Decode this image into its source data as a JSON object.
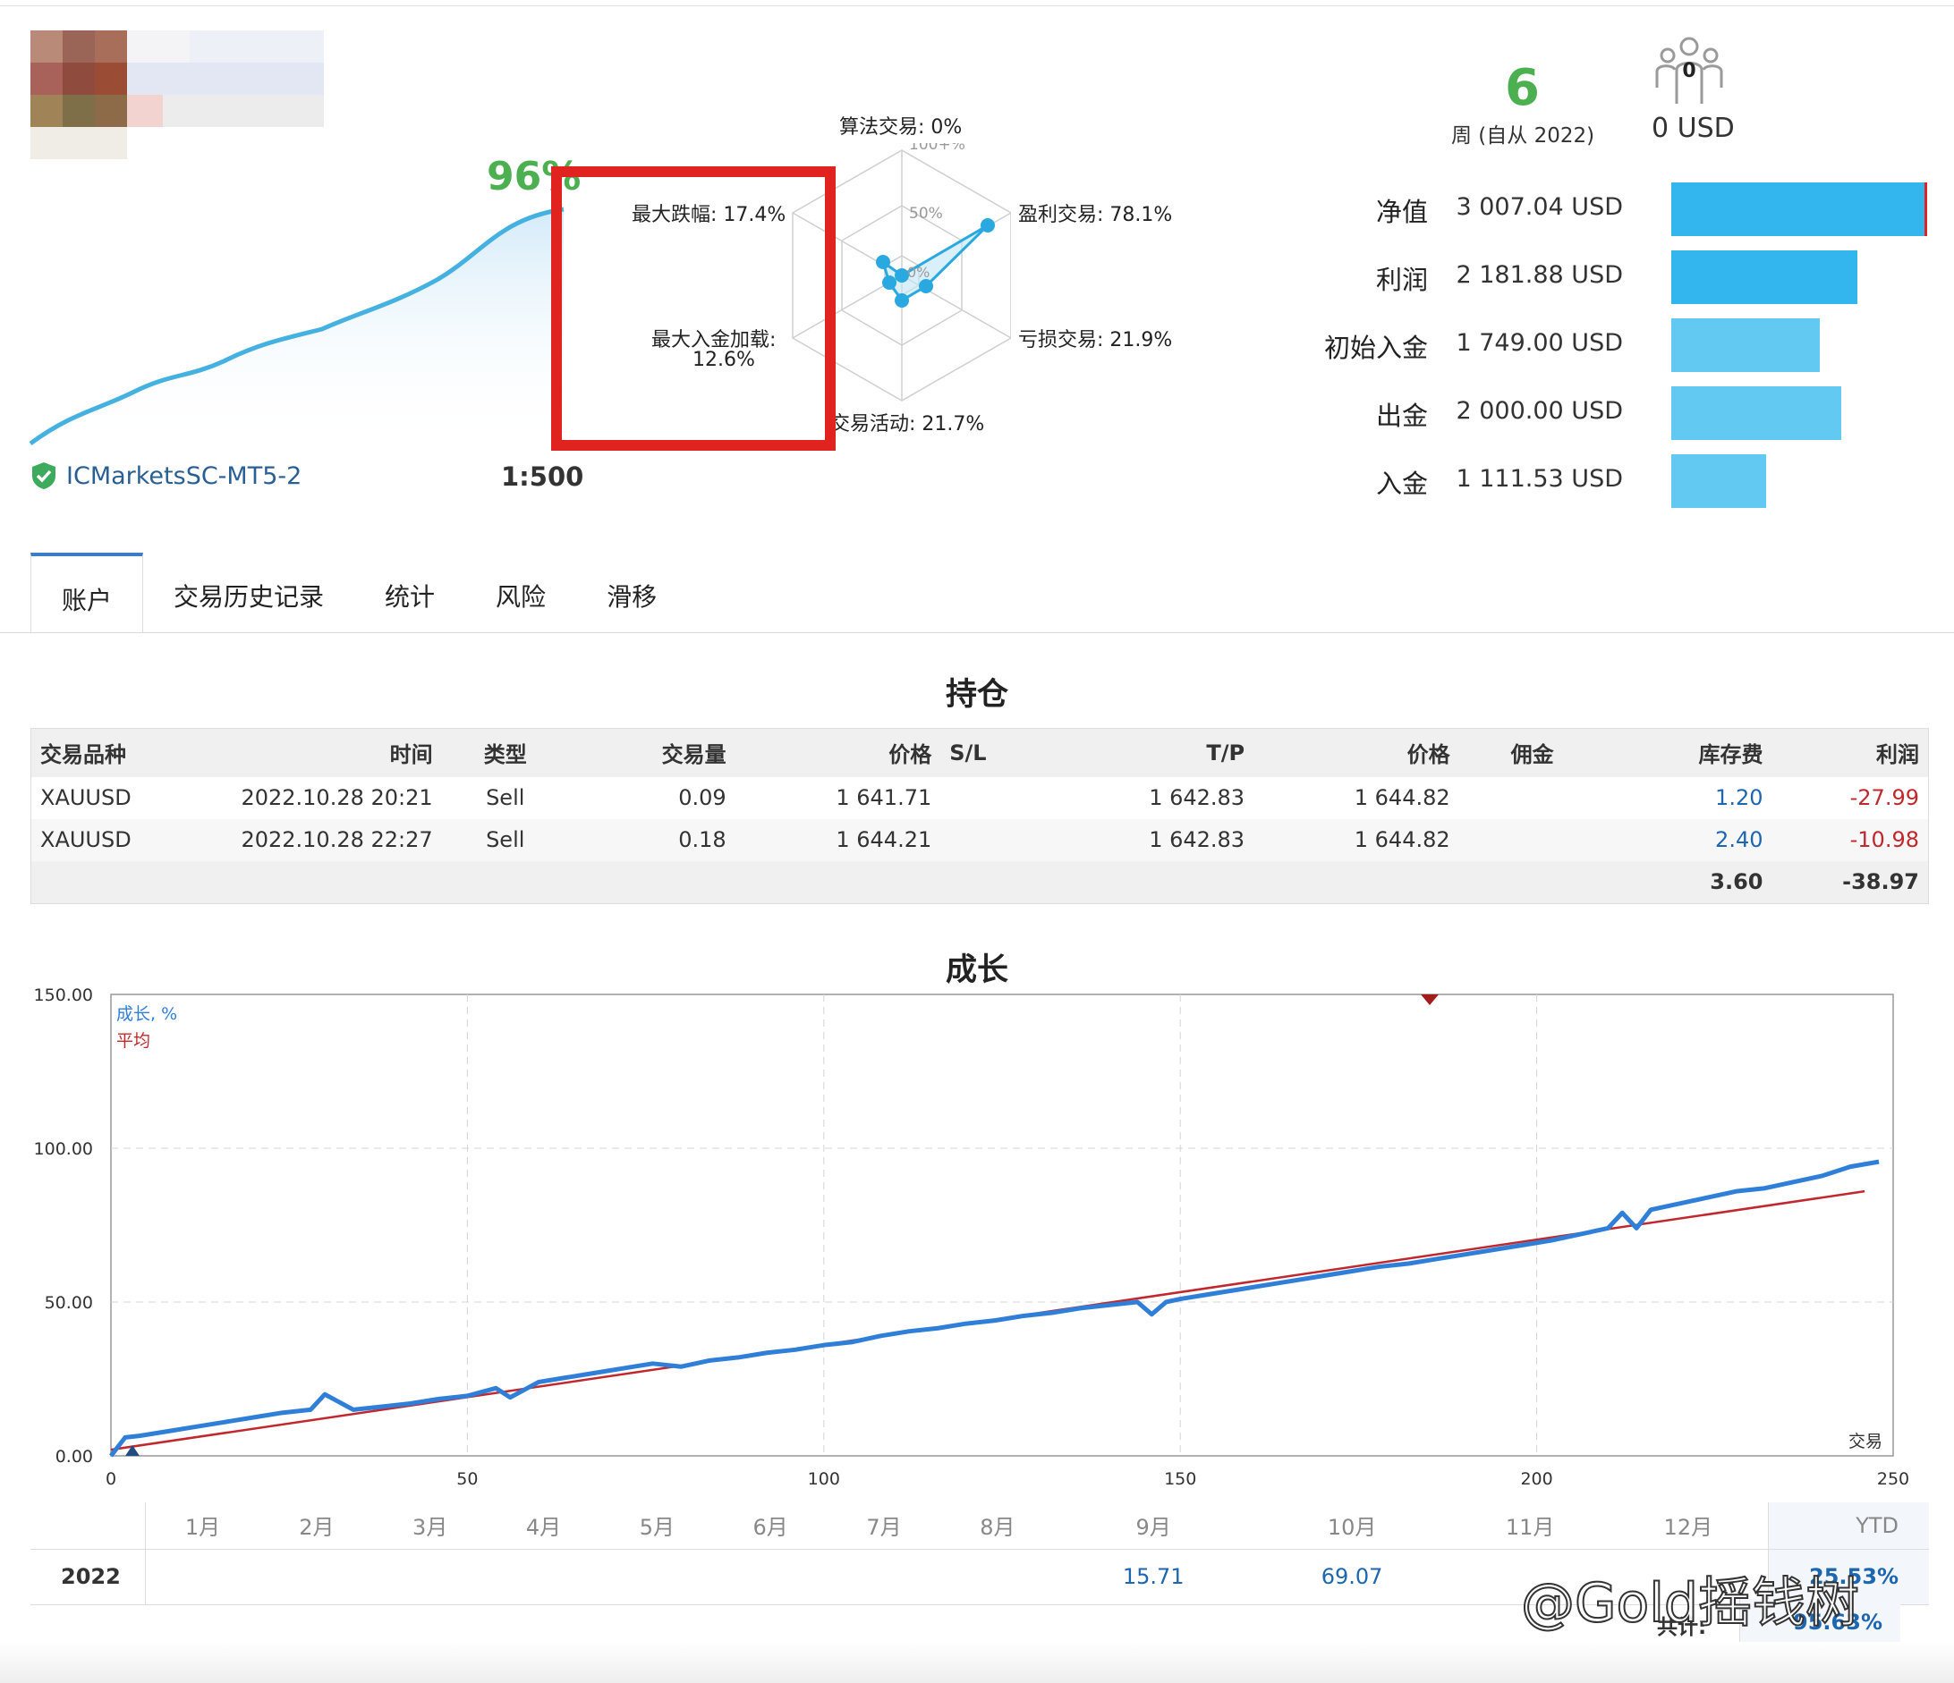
{
  "account": {
    "gain_percent": "96%",
    "broker": "ICMarketsSC-MT5-2",
    "leverage": "1:500"
  },
  "radar": {
    "algo_trading": "算法交易: 0%",
    "profit_trades": "盈利交易: 78.1%",
    "loss_trades": "亏损交易: 21.9%",
    "trading_activity": "交易活动: 21.7%",
    "max_drawdown": "最大跌幅: 17.4%",
    "max_deposit_load_line1": "最大入金加载:",
    "max_deposit_load_line2": "12.6%",
    "scale_100": "100+%",
    "scale_50": "50%",
    "scale_0": "0%",
    "values": {
      "algo": 0,
      "profit": 78.1,
      "loss": 21.9,
      "activity": 21.7,
      "drawdown": 17.4,
      "deposit_load": 12.6
    }
  },
  "weeks": {
    "value": "6",
    "label": "周 (自从 2022)"
  },
  "subscribers": {
    "count": "0",
    "label": "0 USD"
  },
  "financials": [
    {
      "name": "净值",
      "value": "3 007.04 USD",
      "amount": 3007.04,
      "color": "#33b5ee"
    },
    {
      "name": "利润",
      "value": "2 181.88 USD",
      "amount": 2181.88,
      "color": "#33b5ee"
    },
    {
      "name": "初始入金",
      "value": "1 749.00 USD",
      "amount": 1749.0,
      "color": "#62c9f3"
    },
    {
      "name": "出金",
      "value": "2 000.00 USD",
      "amount": 2000.0,
      "color": "#62c9f3"
    },
    {
      "name": "入金",
      "value": "1 111.53 USD",
      "amount": 1111.53,
      "color": "#62c9f3"
    }
  ],
  "tabs": [
    "账户",
    "交易历史记录",
    "统计",
    "风险",
    "滑移"
  ],
  "positions": {
    "title": "持仓",
    "headers": [
      "交易品种",
      "时间",
      "类型",
      "交易量",
      "价格",
      "S/L",
      "T/P",
      "价格",
      "佣金",
      "库存费",
      "利润"
    ],
    "rows": [
      [
        "XAUUSD",
        "2022.10.28 20:21",
        "Sell",
        "0.09",
        "1 641.71",
        "",
        "1 642.83",
        "1 644.82",
        "",
        "1.20",
        "-27.99"
      ],
      [
        "XAUUSD",
        "2022.10.28 22:27",
        "Sell",
        "0.18",
        "1 644.21",
        "",
        "1 642.83",
        "1 644.82",
        "",
        "2.40",
        "-10.98"
      ]
    ],
    "totals": {
      "swap": "3.60",
      "profit": "-38.97"
    }
  },
  "growth": {
    "title": "成长",
    "legend_growth": "成长, %",
    "legend_avg": "平均",
    "x_axis_label": "交易"
  },
  "chart_data": {
    "type": "line",
    "title": "成长",
    "xlabel": "交易",
    "ylabel": "",
    "xlim": [
      0,
      250
    ],
    "ylim": [
      0,
      150
    ],
    "x_ticks": [
      "0",
      "50",
      "100",
      "150",
      "200",
      "250"
    ],
    "y_ticks": [
      "0.00",
      "50.00",
      "100.00",
      "150.00"
    ],
    "series": [
      {
        "name": "成长, %",
        "color": "#2f7fd8",
        "x": [
          0,
          2,
          4,
          8,
          12,
          16,
          20,
          24,
          28,
          30,
          34,
          38,
          42,
          46,
          50,
          54,
          56,
          60,
          64,
          68,
          72,
          76,
          80,
          84,
          88,
          92,
          96,
          100,
          104,
          108,
          112,
          116,
          120,
          124,
          128,
          132,
          136,
          140,
          144,
          146,
          148,
          150,
          154,
          158,
          162,
          166,
          170,
          174,
          178,
          182,
          186,
          190,
          194,
          198,
          202,
          206,
          210,
          212,
          214,
          216,
          220,
          224,
          228,
          232,
          236,
          240,
          244,
          248
        ],
        "y": [
          0,
          6,
          6.5,
          8,
          9.5,
          11,
          12.5,
          14,
          15,
          20,
          15,
          16,
          17,
          18.5,
          19.5,
          22,
          19,
          24,
          25.5,
          27,
          28.5,
          30,
          29,
          31,
          32,
          33.5,
          34.5,
          36,
          37,
          39,
          40.5,
          41.5,
          43,
          44,
          45.5,
          46.5,
          48,
          49,
          50,
          46,
          50,
          51,
          52.5,
          54,
          55.5,
          57,
          58.5,
          60,
          61.5,
          62.5,
          64,
          65.5,
          67,
          68.5,
          70,
          72,
          74,
          79,
          74,
          80,
          82,
          84,
          86,
          87,
          89,
          91,
          94,
          95.6
        ]
      },
      {
        "name": "平均",
        "color": "#c0282d",
        "x": [
          0,
          246
        ],
        "y": [
          2,
          86
        ]
      }
    ]
  },
  "monthly": {
    "months": [
      "1月",
      "2月",
      "3月",
      "4月",
      "5月",
      "6月",
      "7月",
      "8月",
      "9月",
      "10月",
      "11月",
      "12月",
      "YTD"
    ],
    "year": "2022",
    "values": [
      "",
      "",
      "",
      "",
      "",
      "",
      "",
      "",
      "15.71",
      "69.07",
      "",
      "",
      "95.63%"
    ],
    "ytd_visible": "25.53%",
    "total_label": "共计:",
    "total_value": "95.63%"
  },
  "watermark": "@Gold摇钱树"
}
